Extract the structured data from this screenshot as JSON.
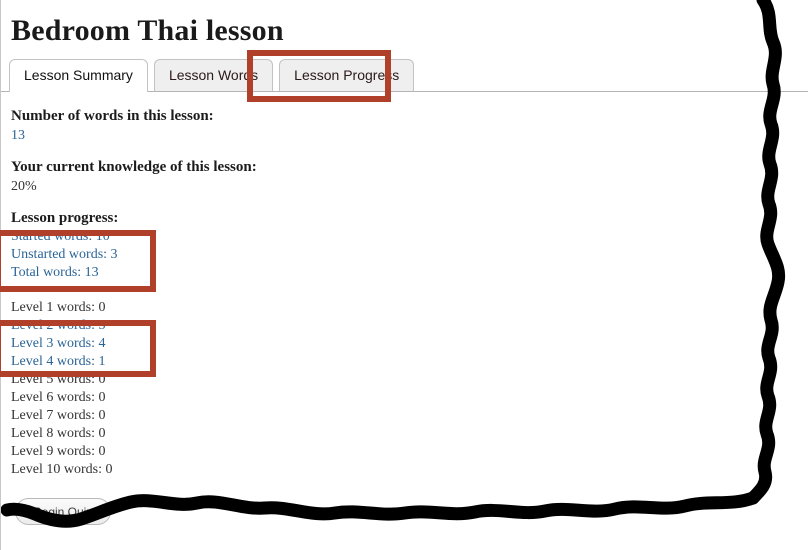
{
  "page": {
    "title": "Bedroom Thai lesson"
  },
  "tabs": [
    {
      "label": "Lesson Summary",
      "active": true
    },
    {
      "label": "Lesson Words",
      "active": false
    },
    {
      "label": "Lesson Progress",
      "active": false
    }
  ],
  "summary": {
    "word_count_label": "Number of words in this lesson:",
    "word_count_value": "13",
    "knowledge_label": "Your current knowledge of this lesson:",
    "knowledge_value": "20%",
    "progress_label": "Lesson progress:"
  },
  "progress": [
    {
      "label": "Started words: 10",
      "link": true
    },
    {
      "label": "Unstarted words: 3",
      "link": true
    },
    {
      "label": "Total words: 13",
      "link": true
    }
  ],
  "levels": [
    {
      "label": "Level 1 words: 0",
      "link": false
    },
    {
      "label": "Level 2 words: 5",
      "link": true
    },
    {
      "label": "Level 3 words: 4",
      "link": true
    },
    {
      "label": "Level 4 words: 1",
      "link": true
    },
    {
      "label": "Level 5 words: 0",
      "link": false
    },
    {
      "label": "Level 6 words: 0",
      "link": false
    },
    {
      "label": "Level 7 words: 0",
      "link": false
    },
    {
      "label": "Level 8 words: 0",
      "link": false
    },
    {
      "label": "Level 9 words: 0",
      "link": false
    },
    {
      "label": "Level 10 words: 0",
      "link": false
    }
  ],
  "footer": {
    "quiz_button_label": "Begin Quiz"
  },
  "annotations": {
    "highlight_color": "#b0402a",
    "scribble_color": "#000000",
    "boxes": [
      {
        "name": "lesson-progress-tab-highlight"
      },
      {
        "name": "lesson-progress-stats-highlight"
      },
      {
        "name": "levels-2-4-highlight"
      }
    ]
  },
  "colors": {
    "link": "#2a6496",
    "text": "#333333",
    "heading": "#1b1b1b",
    "tab_inactive_bg": "#efefef",
    "tab_active_bg": "#ffffff"
  }
}
